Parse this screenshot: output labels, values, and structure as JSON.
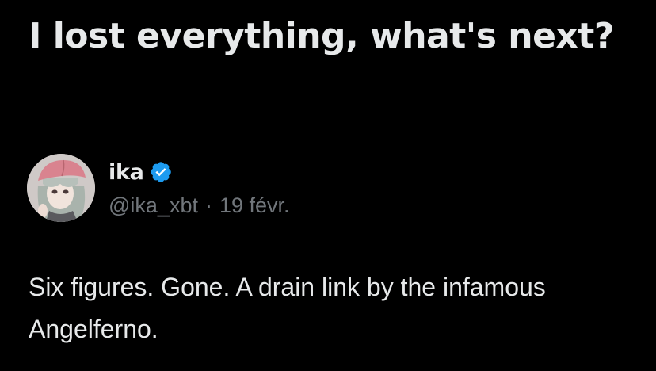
{
  "article": {
    "headline": "I lost everything, what's next?"
  },
  "tweet": {
    "author": {
      "display_name": "ika",
      "handle": "@ika_xbt",
      "verified": true,
      "avatar_icon": "anime-avatar-pink-cap",
      "badge_color": "#1d9bf0"
    },
    "separator": "·",
    "date": "19 févr.",
    "text": "Six figures. Gone. A drain link by the infamous Angelferno."
  }
}
